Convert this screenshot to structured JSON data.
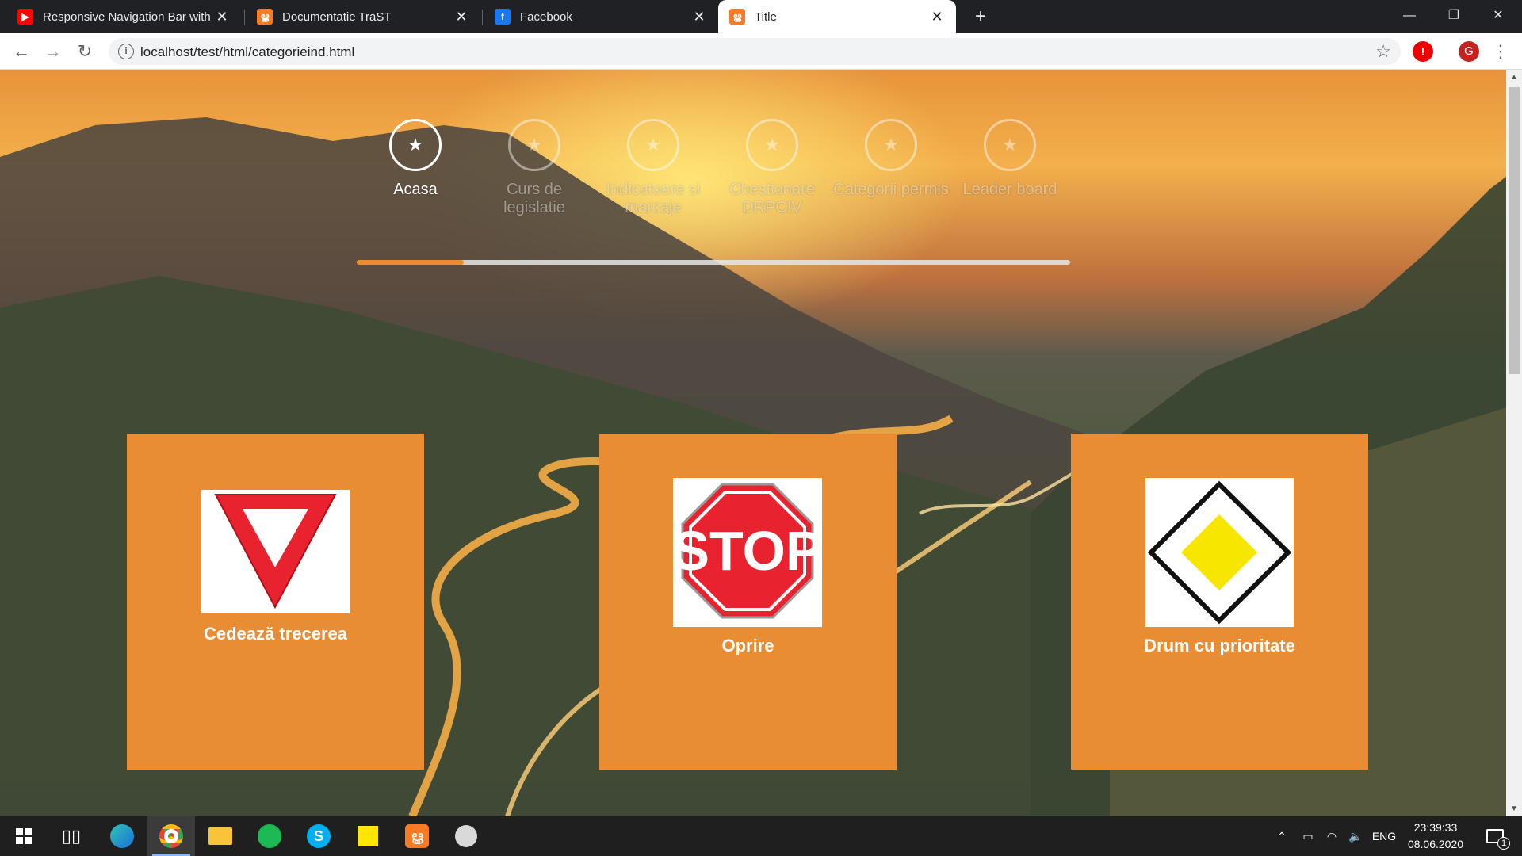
{
  "browser": {
    "tabs": [
      {
        "title": "Responsive Navigation Bar with",
        "favicon": "youtube-icon",
        "color": "#ff0000",
        "active": false
      },
      {
        "title": "Documentatie TraST",
        "favicon": "xampp-icon",
        "color": "#fb7a24",
        "active": false
      },
      {
        "title": "Facebook",
        "favicon": "facebook-icon",
        "color": "#1877f2",
        "active": false
      },
      {
        "title": "Title",
        "favicon": "xampp-icon",
        "color": "#fb7a24",
        "active": true
      }
    ],
    "url": "localhost/test/html/categorieind.html",
    "profile_initial": "G"
  },
  "page": {
    "nav_steps": [
      {
        "label": "Acasa",
        "active": true
      },
      {
        "label": "Curs de legislatie",
        "active": false
      },
      {
        "label": "Indicatoare si marcaje",
        "active": false
      },
      {
        "label": "Chestionare DRPCIV",
        "active": false
      },
      {
        "label": "Categorii permis",
        "active": false
      },
      {
        "label": "Leader board",
        "active": false
      }
    ],
    "progress": 0.15,
    "accent_color": "#e88c32",
    "cards": [
      {
        "caption": "Cedează trecerea",
        "sign": "yield-sign"
      },
      {
        "caption": "Oprire",
        "sign": "stop-sign",
        "sign_text": "STOP"
      },
      {
        "caption": "Drum cu prioritate",
        "sign": "priority-road-sign"
      }
    ]
  },
  "taskbar": {
    "language": "ENG",
    "time": "23:39:33",
    "date": "08.06.2020",
    "notifications": "1"
  }
}
